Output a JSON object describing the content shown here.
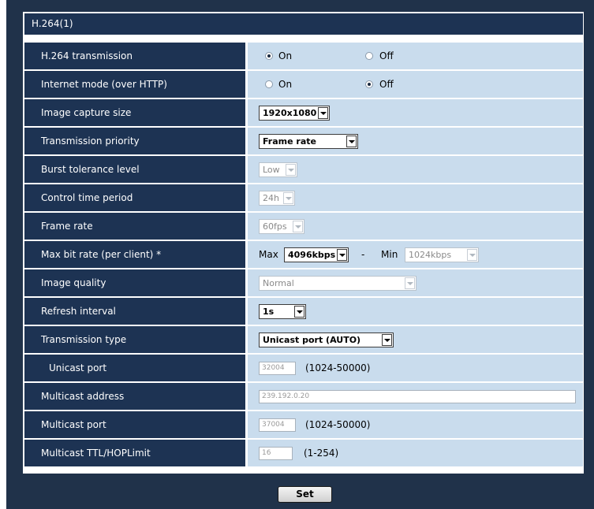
{
  "section_title": "H.264(1)",
  "rows": {
    "transmission": {
      "label": "H.264 transmission",
      "on": "On",
      "off": "Off",
      "selected": "On"
    },
    "internet_mode": {
      "label": "Internet mode (over HTTP)",
      "on": "On",
      "off": "Off",
      "selected": "Off"
    },
    "capture_size": {
      "label": "Image capture size",
      "value": "1920x1080"
    },
    "priority": {
      "label": "Transmission priority",
      "value": "Frame rate"
    },
    "burst": {
      "label": "Burst tolerance level",
      "value": "Low"
    },
    "control_period": {
      "label": "Control time period",
      "value": "24h"
    },
    "frame_rate": {
      "label": "Frame rate",
      "value": "60fps"
    },
    "max_bitrate": {
      "label": "Max bit rate (per client) *",
      "max_label": "Max",
      "max_value": "4096kbps",
      "dash": "-",
      "min_label": "Min",
      "min_value": "1024kbps"
    },
    "image_quality": {
      "label": "Image quality",
      "value": "Normal"
    },
    "refresh": {
      "label": "Refresh interval",
      "value": "1s"
    },
    "trans_type": {
      "label": "Transmission type",
      "value": "Unicast port (AUTO)"
    },
    "unicast_port": {
      "label": "Unicast port",
      "value": "32004",
      "range": "(1024-50000)"
    },
    "mc_address": {
      "label": "Multicast address",
      "value": "239.192.0.20"
    },
    "mc_port": {
      "label": "Multicast port",
      "value": "37004",
      "range": "(1024-50000)"
    },
    "mc_ttl": {
      "label": "Multicast TTL/HOPLimit",
      "value": "16",
      "range": "(1-254)"
    }
  },
  "set_button": "Set"
}
